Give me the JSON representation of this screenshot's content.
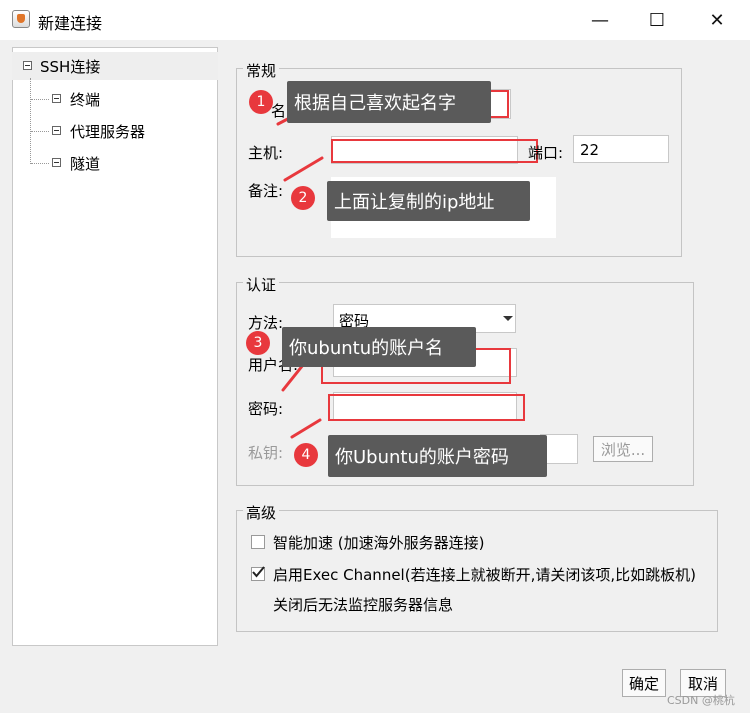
{
  "window": {
    "title": "新建连接",
    "minimize_glyph": "—",
    "maximize_glyph": "☐",
    "close_glyph": "✕"
  },
  "tree": {
    "root": "SSH连接",
    "children": [
      "终端",
      "代理服务器",
      "隧道"
    ]
  },
  "general": {
    "title": "常规",
    "name_label_fragment": "名",
    "host_label": "主机:",
    "port_label": "端口:",
    "port_value": "22",
    "note_label": "备注:"
  },
  "auth": {
    "title": "认证",
    "method_label": "方法:",
    "method_value": "密码",
    "username_label": "用户名:",
    "password_label": "密码:",
    "private_key_label": "私钥:",
    "browse_label": "浏览..."
  },
  "advanced": {
    "title": "高级",
    "smart_accel_label": "智能加速 (加速海外服务器连接)",
    "smart_accel_checked": false,
    "exec_channel_label": "启用Exec Channel(若连接上就被断开,请关闭该项,比如跳板机)",
    "exec_channel_checked": true,
    "exec_channel_note": "关闭后无法监控服务器信息"
  },
  "buttons": {
    "ok": "确定",
    "cancel": "取消"
  },
  "annotations": [
    {
      "number": "1",
      "text": "根据自己喜欢起名字"
    },
    {
      "number": "2",
      "text": "上面让复制的ip地址"
    },
    {
      "number": "3",
      "text": "你ubuntu的账户名"
    },
    {
      "number": "4",
      "text": "你Ubuntu的账户密码"
    }
  ],
  "watermark": "CSDN @桃杭",
  "colors": {
    "annotation_red": "#e8383d",
    "callout_bg": "#5a5a5a",
    "dialog_bg": "#f0f0f0"
  }
}
